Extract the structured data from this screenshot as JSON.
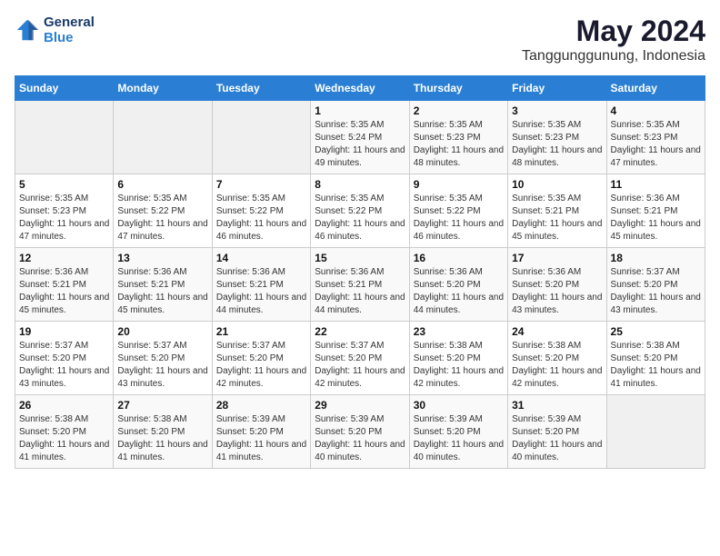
{
  "logo": {
    "general": "General",
    "blue": "Blue"
  },
  "header": {
    "title": "May 2024",
    "subtitle": "Tanggunggunung, Indonesia"
  },
  "weekdays": [
    "Sunday",
    "Monday",
    "Tuesday",
    "Wednesday",
    "Thursday",
    "Friday",
    "Saturday"
  ],
  "weeks": [
    [
      {
        "day": "",
        "sunrise": "",
        "sunset": "",
        "daylight": ""
      },
      {
        "day": "",
        "sunrise": "",
        "sunset": "",
        "daylight": ""
      },
      {
        "day": "",
        "sunrise": "",
        "sunset": "",
        "daylight": ""
      },
      {
        "day": "1",
        "sunrise": "Sunrise: 5:35 AM",
        "sunset": "Sunset: 5:24 PM",
        "daylight": "Daylight: 11 hours and 49 minutes."
      },
      {
        "day": "2",
        "sunrise": "Sunrise: 5:35 AM",
        "sunset": "Sunset: 5:23 PM",
        "daylight": "Daylight: 11 hours and 48 minutes."
      },
      {
        "day": "3",
        "sunrise": "Sunrise: 5:35 AM",
        "sunset": "Sunset: 5:23 PM",
        "daylight": "Daylight: 11 hours and 48 minutes."
      },
      {
        "day": "4",
        "sunrise": "Sunrise: 5:35 AM",
        "sunset": "Sunset: 5:23 PM",
        "daylight": "Daylight: 11 hours and 47 minutes."
      }
    ],
    [
      {
        "day": "5",
        "sunrise": "Sunrise: 5:35 AM",
        "sunset": "Sunset: 5:23 PM",
        "daylight": "Daylight: 11 hours and 47 minutes."
      },
      {
        "day": "6",
        "sunrise": "Sunrise: 5:35 AM",
        "sunset": "Sunset: 5:22 PM",
        "daylight": "Daylight: 11 hours and 47 minutes."
      },
      {
        "day": "7",
        "sunrise": "Sunrise: 5:35 AM",
        "sunset": "Sunset: 5:22 PM",
        "daylight": "Daylight: 11 hours and 46 minutes."
      },
      {
        "day": "8",
        "sunrise": "Sunrise: 5:35 AM",
        "sunset": "Sunset: 5:22 PM",
        "daylight": "Daylight: 11 hours and 46 minutes."
      },
      {
        "day": "9",
        "sunrise": "Sunrise: 5:35 AM",
        "sunset": "Sunset: 5:22 PM",
        "daylight": "Daylight: 11 hours and 46 minutes."
      },
      {
        "day": "10",
        "sunrise": "Sunrise: 5:35 AM",
        "sunset": "Sunset: 5:21 PM",
        "daylight": "Daylight: 11 hours and 45 minutes."
      },
      {
        "day": "11",
        "sunrise": "Sunrise: 5:36 AM",
        "sunset": "Sunset: 5:21 PM",
        "daylight": "Daylight: 11 hours and 45 minutes."
      }
    ],
    [
      {
        "day": "12",
        "sunrise": "Sunrise: 5:36 AM",
        "sunset": "Sunset: 5:21 PM",
        "daylight": "Daylight: 11 hours and 45 minutes."
      },
      {
        "day": "13",
        "sunrise": "Sunrise: 5:36 AM",
        "sunset": "Sunset: 5:21 PM",
        "daylight": "Daylight: 11 hours and 45 minutes."
      },
      {
        "day": "14",
        "sunrise": "Sunrise: 5:36 AM",
        "sunset": "Sunset: 5:21 PM",
        "daylight": "Daylight: 11 hours and 44 minutes."
      },
      {
        "day": "15",
        "sunrise": "Sunrise: 5:36 AM",
        "sunset": "Sunset: 5:21 PM",
        "daylight": "Daylight: 11 hours and 44 minutes."
      },
      {
        "day": "16",
        "sunrise": "Sunrise: 5:36 AM",
        "sunset": "Sunset: 5:20 PM",
        "daylight": "Daylight: 11 hours and 44 minutes."
      },
      {
        "day": "17",
        "sunrise": "Sunrise: 5:36 AM",
        "sunset": "Sunset: 5:20 PM",
        "daylight": "Daylight: 11 hours and 43 minutes."
      },
      {
        "day": "18",
        "sunrise": "Sunrise: 5:37 AM",
        "sunset": "Sunset: 5:20 PM",
        "daylight": "Daylight: 11 hours and 43 minutes."
      }
    ],
    [
      {
        "day": "19",
        "sunrise": "Sunrise: 5:37 AM",
        "sunset": "Sunset: 5:20 PM",
        "daylight": "Daylight: 11 hours and 43 minutes."
      },
      {
        "day": "20",
        "sunrise": "Sunrise: 5:37 AM",
        "sunset": "Sunset: 5:20 PM",
        "daylight": "Daylight: 11 hours and 43 minutes."
      },
      {
        "day": "21",
        "sunrise": "Sunrise: 5:37 AM",
        "sunset": "Sunset: 5:20 PM",
        "daylight": "Daylight: 11 hours and 42 minutes."
      },
      {
        "day": "22",
        "sunrise": "Sunrise: 5:37 AM",
        "sunset": "Sunset: 5:20 PM",
        "daylight": "Daylight: 11 hours and 42 minutes."
      },
      {
        "day": "23",
        "sunrise": "Sunrise: 5:38 AM",
        "sunset": "Sunset: 5:20 PM",
        "daylight": "Daylight: 11 hours and 42 minutes."
      },
      {
        "day": "24",
        "sunrise": "Sunrise: 5:38 AM",
        "sunset": "Sunset: 5:20 PM",
        "daylight": "Daylight: 11 hours and 42 minutes."
      },
      {
        "day": "25",
        "sunrise": "Sunrise: 5:38 AM",
        "sunset": "Sunset: 5:20 PM",
        "daylight": "Daylight: 11 hours and 41 minutes."
      }
    ],
    [
      {
        "day": "26",
        "sunrise": "Sunrise: 5:38 AM",
        "sunset": "Sunset: 5:20 PM",
        "daylight": "Daylight: 11 hours and 41 minutes."
      },
      {
        "day": "27",
        "sunrise": "Sunrise: 5:38 AM",
        "sunset": "Sunset: 5:20 PM",
        "daylight": "Daylight: 11 hours and 41 minutes."
      },
      {
        "day": "28",
        "sunrise": "Sunrise: 5:39 AM",
        "sunset": "Sunset: 5:20 PM",
        "daylight": "Daylight: 11 hours and 41 minutes."
      },
      {
        "day": "29",
        "sunrise": "Sunrise: 5:39 AM",
        "sunset": "Sunset: 5:20 PM",
        "daylight": "Daylight: 11 hours and 40 minutes."
      },
      {
        "day": "30",
        "sunrise": "Sunrise: 5:39 AM",
        "sunset": "Sunset: 5:20 PM",
        "daylight": "Daylight: 11 hours and 40 minutes."
      },
      {
        "day": "31",
        "sunrise": "Sunrise: 5:39 AM",
        "sunset": "Sunset: 5:20 PM",
        "daylight": "Daylight: 11 hours and 40 minutes."
      },
      {
        "day": "",
        "sunrise": "",
        "sunset": "",
        "daylight": ""
      }
    ]
  ]
}
